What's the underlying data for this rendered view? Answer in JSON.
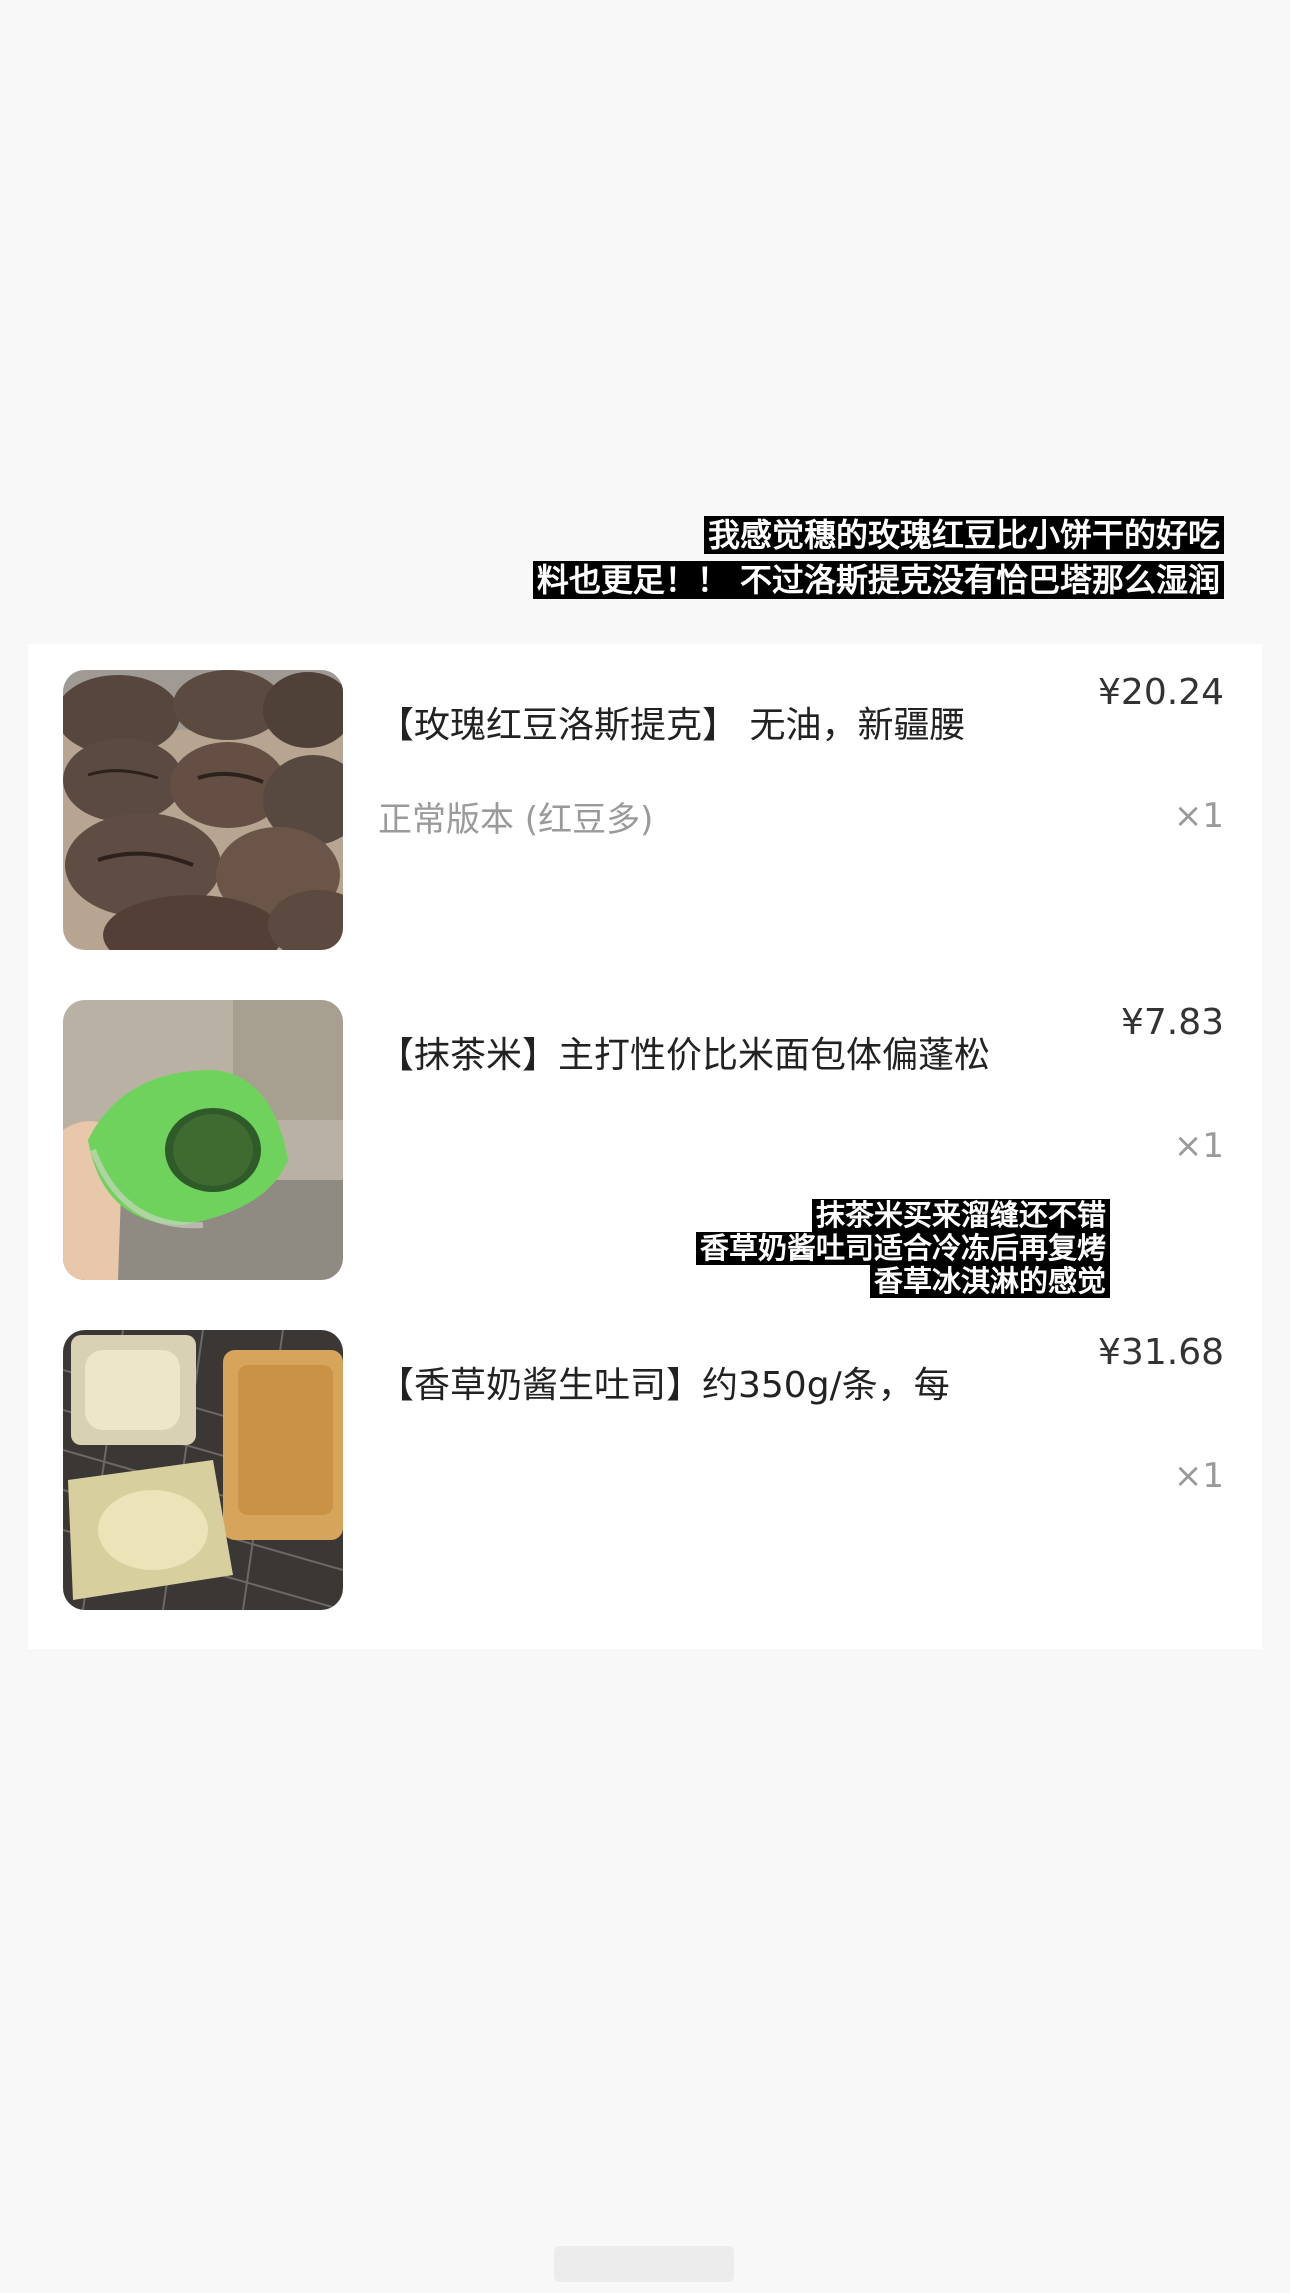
{
  "top_caption": {
    "line1": "我感觉穗的玫瑰红豆比小饼干的好吃",
    "line2": "料也更足！！ 不过洛斯提克没有恰巴塔那么湿润"
  },
  "items": [
    {
      "title": "【玫瑰红豆洛斯提克】 无油，新疆腰",
      "variant": "正常版本 (红豆多)",
      "price": "¥20.24",
      "qty": "×1"
    },
    {
      "title": "【抹茶米】主打性价比米面包体偏蓬松",
      "variant": "",
      "price": "¥7.83",
      "qty": "×1"
    },
    {
      "title": "【香草奶酱生吐司】约350g/条，每",
      "variant": "",
      "price": "¥31.68",
      "qty": "×1"
    }
  ],
  "mid_caption": {
    "line1": "抹茶米买来溜缝还不错",
    "line2": "香草奶酱吐司适合冷冻后再复烤",
    "line3": "香草冰淇淋的感觉"
  },
  "colors": {
    "background": "#f8f8f9",
    "card": "#ffffff",
    "caption_bg": "#000000",
    "caption_text": "#ffffff",
    "muted_text": "#9a9a9a"
  }
}
